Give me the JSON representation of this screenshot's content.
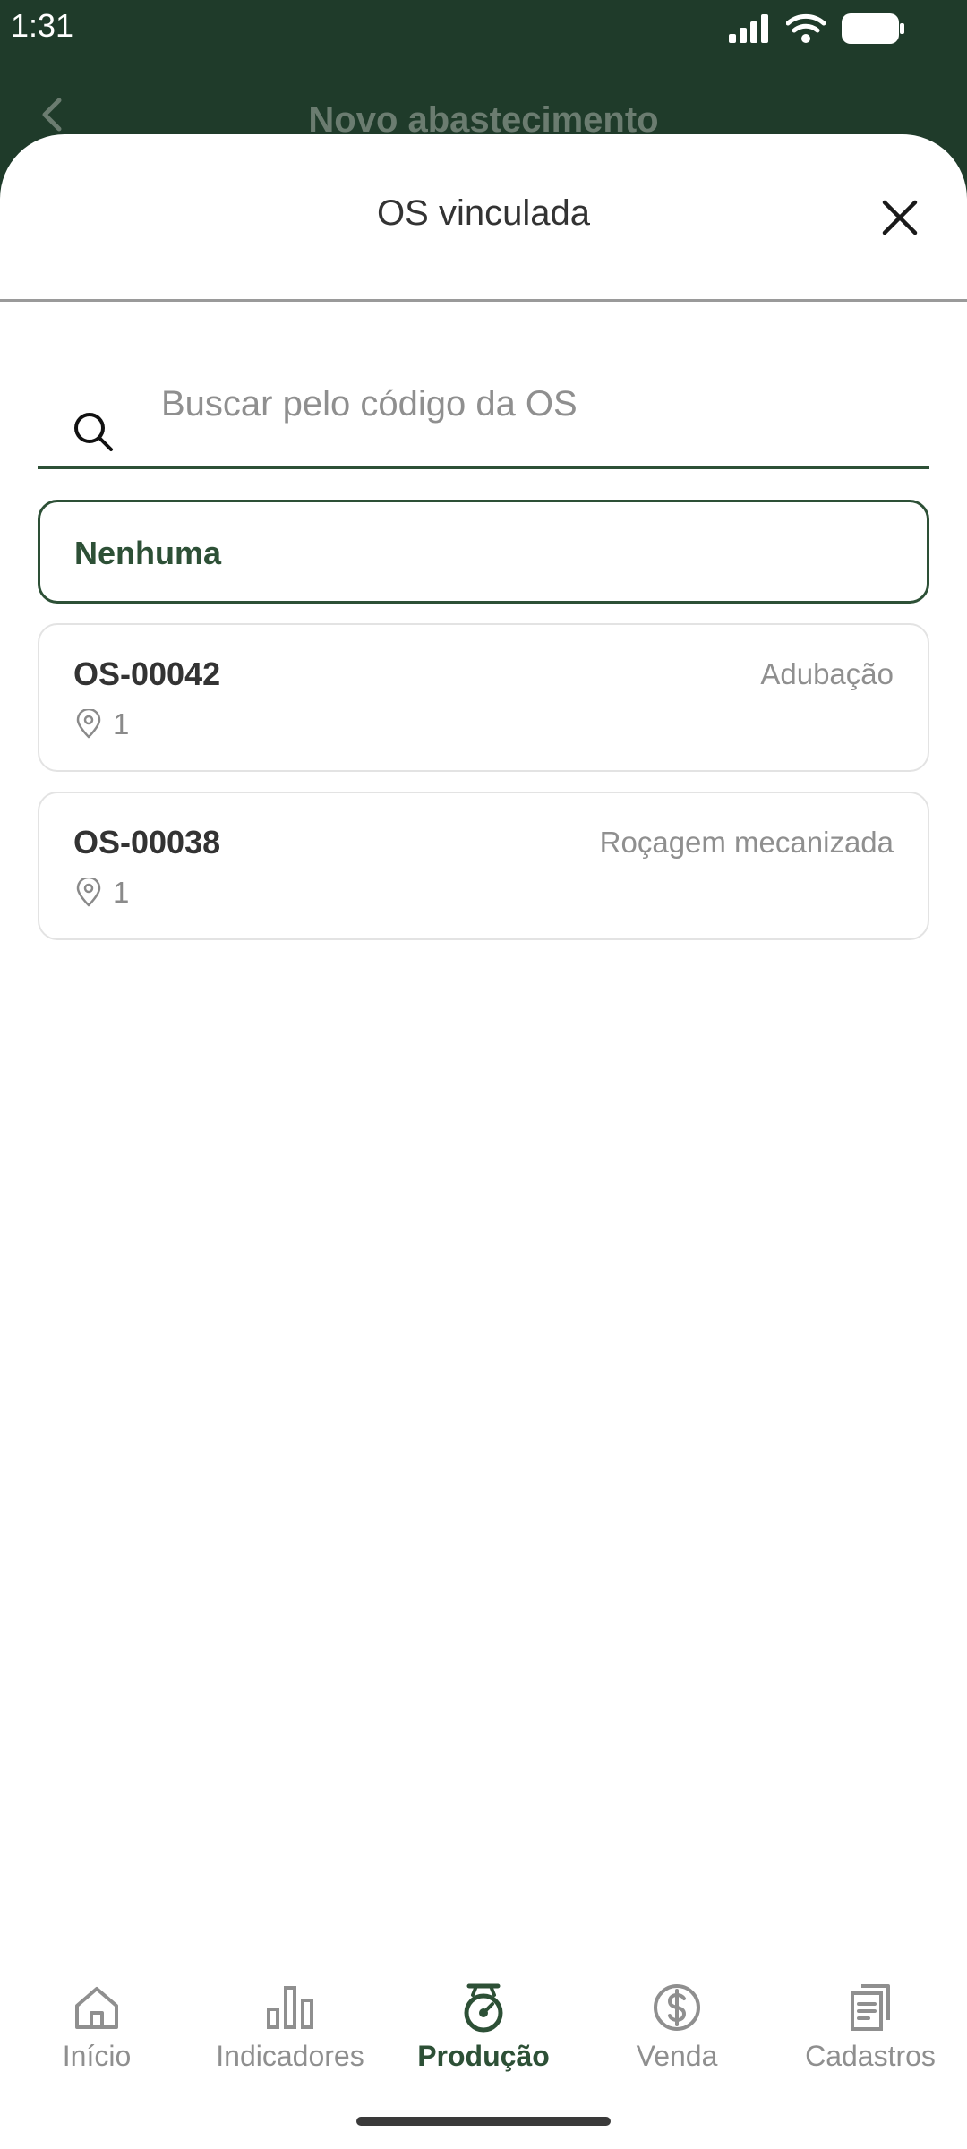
{
  "status_bar": {
    "time": "1:31"
  },
  "background_header": {
    "title": "Novo abastecimento"
  },
  "sheet": {
    "title": "OS vinculada",
    "search_placeholder": "Buscar pelo código da OS",
    "none_option_label": "Nenhuma",
    "orders": [
      {
        "code": "OS-00042",
        "type": "Adubação",
        "location_count": "1"
      },
      {
        "code": "OS-00038",
        "type": "Roçagem mecanizada",
        "location_count": "1"
      }
    ]
  },
  "bottom_nav": {
    "items": [
      {
        "label": "Início",
        "icon": "home-icon"
      },
      {
        "label": "Indicadores",
        "icon": "bar-chart-icon"
      },
      {
        "label": "Produção",
        "icon": "scale-icon",
        "active": true
      },
      {
        "label": "Venda",
        "icon": "dollar-icon"
      },
      {
        "label": "Cadastros",
        "icon": "documents-icon"
      }
    ]
  },
  "colors": {
    "header_background": "#1f3b2a",
    "accent": "#2d5036",
    "muted_text": "#8f8f8f",
    "card_border": "#e3e3e3"
  }
}
